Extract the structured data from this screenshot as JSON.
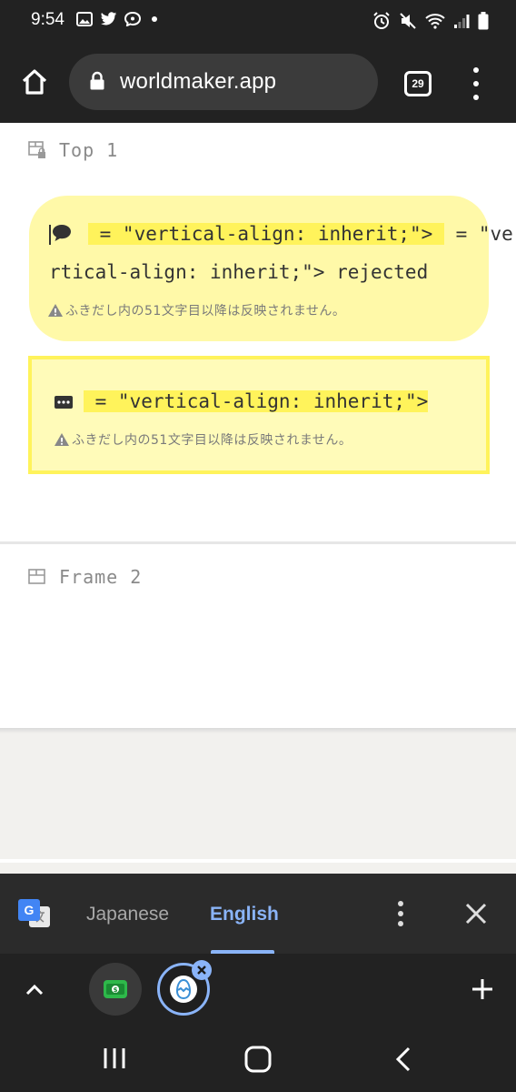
{
  "status_bar": {
    "time": "9:54",
    "left_icons": [
      "image-icon",
      "twitter-icon",
      "chat-icon",
      "dot-icon"
    ],
    "right_icons": [
      "alarm-icon",
      "mute-icon",
      "wifi-icon",
      "signal-icon",
      "battery-icon"
    ]
  },
  "browser": {
    "url": "worldmaker.app",
    "tab_count": "29"
  },
  "page": {
    "frames": [
      {
        "label": "Top 1"
      },
      {
        "label": "Frame 2"
      }
    ],
    "bubble1": {
      "line1_highlight": " = \"vertical-align: inherit;\"> ",
      "line1_rest": " = \"ve",
      "line2": "rtical-align: inherit;\"> rejected",
      "warning": "ふきだし内の51文字目以降は反映されません。"
    },
    "bubble2": {
      "text": " = \"vertical-align: inherit;\">",
      "warning": "ふきだし内の51文字目以降は反映されません。"
    }
  },
  "translate_bar": {
    "source_lang": "Japanese",
    "target_lang": "English"
  },
  "colors": {
    "accent_blue": "#8ab4f8",
    "bubble_yellow": "#fff9a8",
    "highlight_yellow": "#fff35b"
  }
}
